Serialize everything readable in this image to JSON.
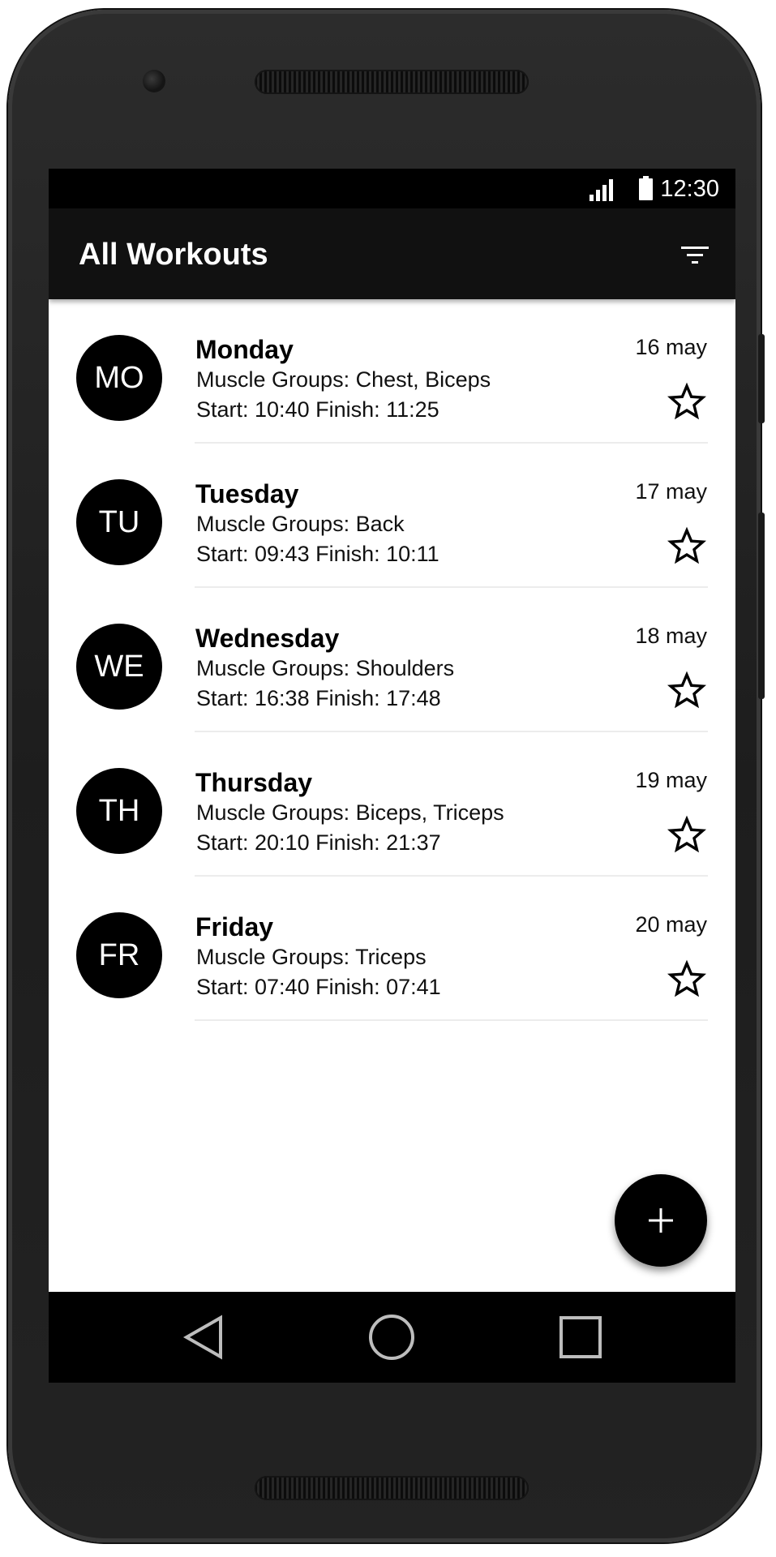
{
  "status_bar": {
    "time": "12:30",
    "signal_icon": "cell-signal-icon",
    "battery_icon": "battery-icon"
  },
  "app_bar": {
    "title": "All Workouts",
    "filter_icon": "filter-icon"
  },
  "workouts": [
    {
      "initials": "MO",
      "day": "Monday",
      "groups": "Muscle Groups: Chest, Biceps",
      "times": "Start: 10:40 Finish: 11:25",
      "date": "16 may",
      "starred": false
    },
    {
      "initials": "TU",
      "day": "Tuesday",
      "groups": "Muscle Groups: Back",
      "times": "Start: 09:43 Finish: 10:11",
      "date": "17 may",
      "starred": false
    },
    {
      "initials": "WE",
      "day": "Wednesday",
      "groups": "Muscle Groups: Shoulders",
      "times": "Start: 16:38 Finish: 17:48",
      "date": "18 may",
      "starred": false
    },
    {
      "initials": "TH",
      "day": "Thursday",
      "groups": "Muscle Groups: Biceps, Triceps",
      "times": "Start: 20:10 Finish: 21:37",
      "date": "19 may",
      "starred": false
    },
    {
      "initials": "FR",
      "day": "Friday",
      "groups": "Muscle Groups: Triceps",
      "times": "Start: 07:40 Finish: 07:41",
      "date": "20 may",
      "starred": false
    }
  ],
  "fab": {
    "icon": "plus-icon"
  },
  "nav_bar": {
    "back_icon": "back-triangle-icon",
    "home_icon": "home-circle-icon",
    "recents_icon": "recents-square-icon"
  },
  "colors": {
    "app_bar": "#111111",
    "status_bar": "#000000",
    "avatar": "#000000",
    "fab": "#000000",
    "nav_bar": "#000000",
    "frame": "#232323"
  }
}
